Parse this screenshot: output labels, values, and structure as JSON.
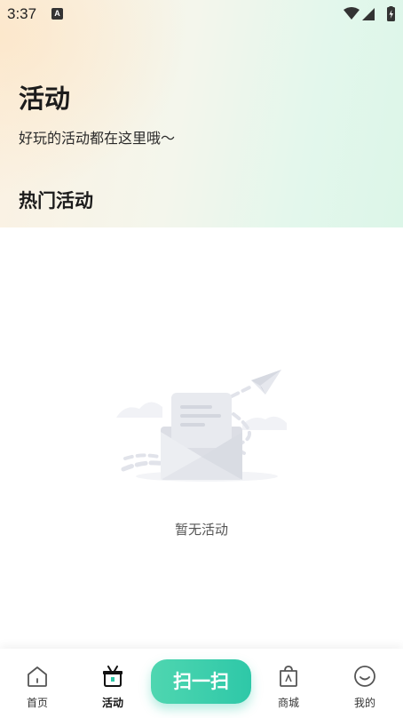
{
  "status_bar": {
    "time": "3:37",
    "notification_icon": "a-icon",
    "wifi_icon": "wifi-icon",
    "signal_icon": "signal-icon",
    "battery_icon": "battery-charging-icon"
  },
  "header": {
    "title": "活动",
    "subtitle": "好玩的活动都在这里哦～",
    "section_title": "热门活动"
  },
  "empty_state": {
    "illustration_icon": "empty-envelope-paper-plane",
    "text": "暂无活动"
  },
  "tabbar": {
    "tabs": [
      {
        "label": "首页",
        "icon": "home-icon",
        "active": false
      },
      {
        "label": "活动",
        "icon": "activity-basket-icon",
        "active": true
      },
      {
        "label": "扫一扫",
        "icon": "scan",
        "active": false
      },
      {
        "label": "商城",
        "icon": "shopping-bag-icon",
        "active": false
      },
      {
        "label": "我的",
        "icon": "profile-smile-icon",
        "active": false
      }
    ]
  },
  "colors": {
    "accent": "#2ec8a8",
    "header_warm": "#fbf1e2",
    "header_mint": "#dcf6e8"
  }
}
